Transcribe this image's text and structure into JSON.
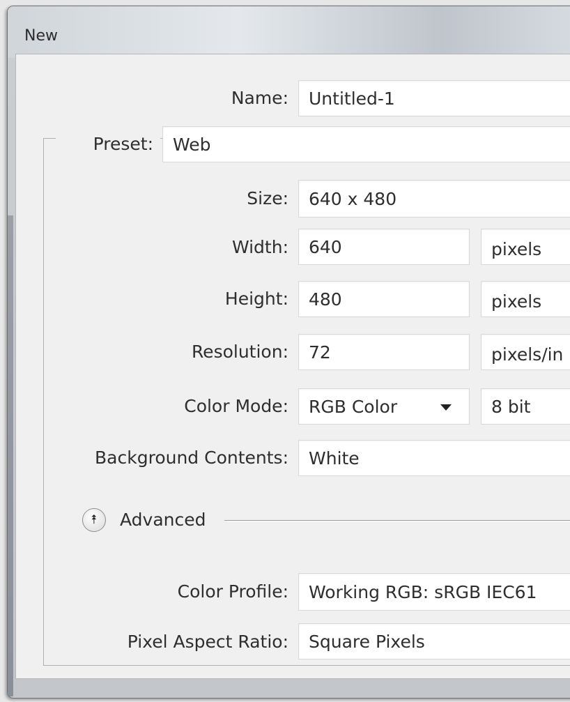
{
  "window": {
    "title": "New"
  },
  "form": {
    "name": {
      "label": "Name:",
      "value": "Untitled-1"
    },
    "preset": {
      "label": "Preset:",
      "value": "Web"
    },
    "size": {
      "label": "Size:",
      "value": "640 x 480"
    },
    "width": {
      "label": "Width:",
      "value": "640",
      "unit": "pixels"
    },
    "height": {
      "label": "Height:",
      "value": "480",
      "unit": "pixels"
    },
    "resolution": {
      "label": "Resolution:",
      "value": "72",
      "unit": "pixels/in"
    },
    "color_mode": {
      "label": "Color Mode:",
      "value": "RGB Color",
      "depth": "8 bit"
    },
    "background": {
      "label": "Background Contents:",
      "value": "White"
    },
    "advanced": {
      "label": "Advanced"
    },
    "color_profile": {
      "label": "Color Profile:",
      "value": "Working RGB:  sRGB IEC61"
    },
    "pixel_aspect": {
      "label": "Pixel Aspect Ratio:",
      "value": "Square Pixels"
    }
  },
  "icons": {
    "advanced_toggle": "collapse-chevrons-icon",
    "dropdown": "chevron-down-icon"
  }
}
